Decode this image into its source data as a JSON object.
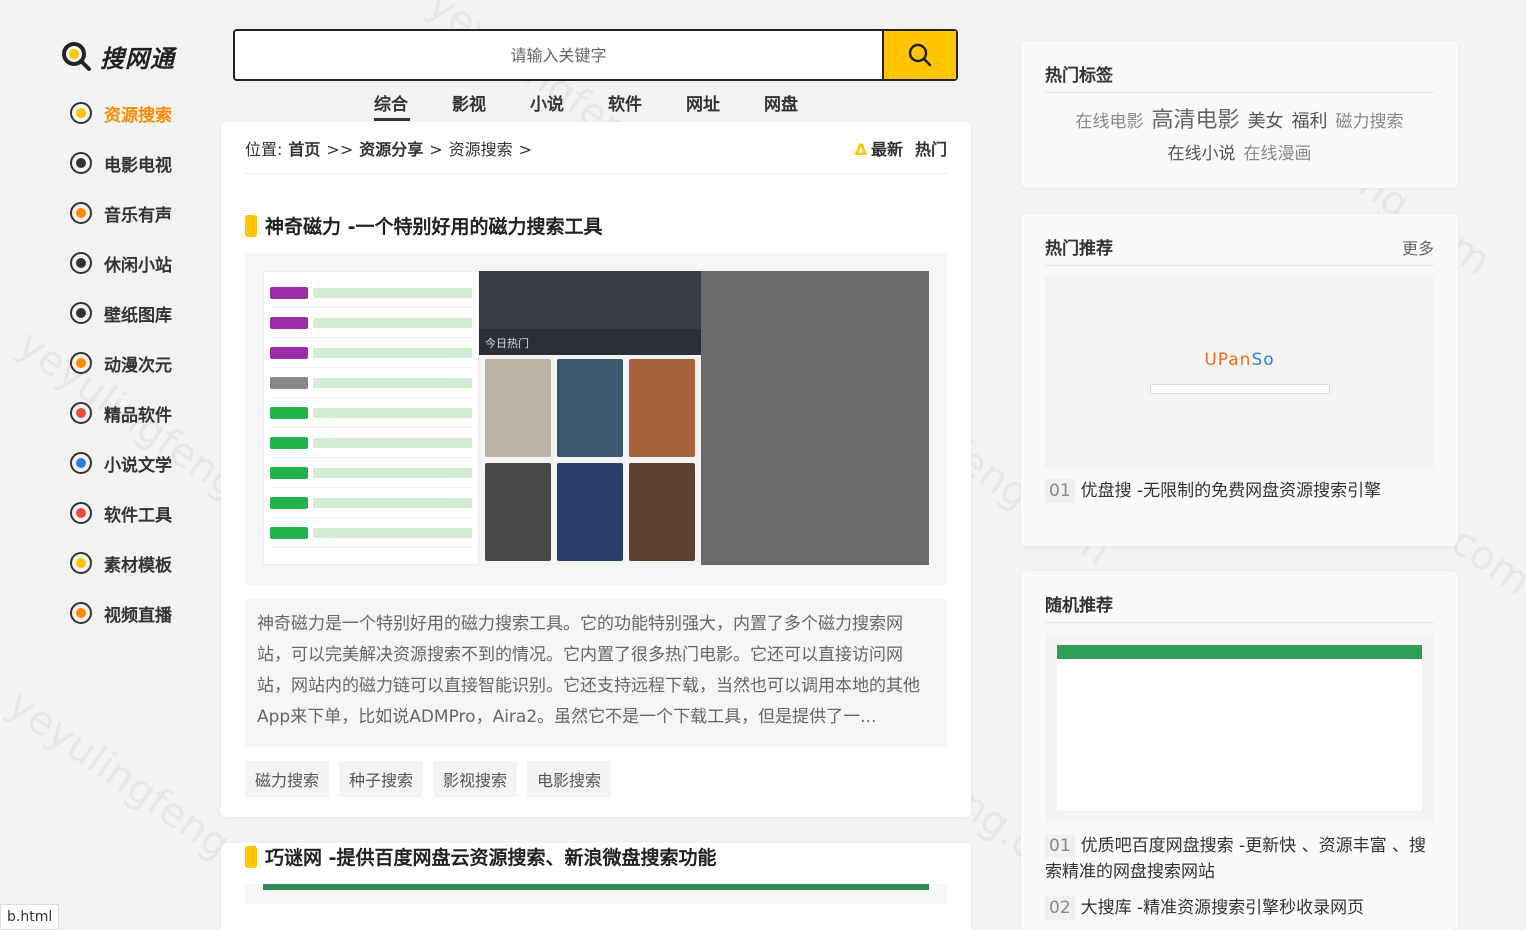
{
  "site": {
    "logo_text": "搜网通"
  },
  "search": {
    "placeholder": "请输入关键字"
  },
  "nav": [
    {
      "label": "资源搜索",
      "icon": "bulb-icon",
      "active": true
    },
    {
      "label": "电影电视",
      "icon": "film-reel-icon"
    },
    {
      "label": "音乐有声",
      "icon": "music-note-icon"
    },
    {
      "label": "休闲小站",
      "icon": "gamepad-icon"
    },
    {
      "label": "壁纸图库",
      "icon": "camera-icon"
    },
    {
      "label": "动漫次元",
      "icon": "anime-face-icon"
    },
    {
      "label": "精品软件",
      "icon": "software-icon"
    },
    {
      "label": "小说文学",
      "icon": "book-icon"
    },
    {
      "label": "软件工具",
      "icon": "tool-icon"
    },
    {
      "label": "素材模板",
      "icon": "idea-icon"
    },
    {
      "label": "视频直播",
      "icon": "video-icon"
    }
  ],
  "categories": [
    {
      "label": "综合",
      "active": true
    },
    {
      "label": "影视"
    },
    {
      "label": "小说"
    },
    {
      "label": "软件"
    },
    {
      "label": "网址"
    },
    {
      "label": "网盘"
    }
  ],
  "breadcrumb": {
    "prefix": "位置:",
    "home": "首页",
    "sep1": ">>",
    "section": "资源分享",
    "sep2": ">",
    "current": "资源搜索",
    "sep3": ">"
  },
  "sort": {
    "newest": "最新",
    "hot": "热门"
  },
  "posts": [
    {
      "title": "神奇磁力 -一个特别好用的磁力搜索工具",
      "thumb_hot_label": "今日热门",
      "description": "神奇磁力是一个特别好用的磁力搜索工具。它的功能特别强大，内置了多个磁力搜索网站，可以完美解决资源搜索不到的情况。它内置了很多热门电影。它还可以直接访问网站，网站内的磁力链可以直接智能识别。它还支持远程下载，当然也可以调用本地的其他App来下单，比如说ADMPro，Aira2。虽然它不是一个下载工具，但是提供了一...",
      "tags": [
        "磁力搜索",
        "种子搜索",
        "影视搜索",
        "电影搜索"
      ]
    },
    {
      "title": "巧谜网 -提供百度网盘云资源搜索、新浪微盘搜索功能"
    }
  ],
  "hot_tags": {
    "title": "热门标签",
    "tags": [
      "在线电影",
      "高清电影",
      "美女",
      "福利",
      "磁力搜索",
      "在线小说",
      "在线漫画"
    ]
  },
  "hot_rec": {
    "title": "热门推荐",
    "more": "更多",
    "thumb_logo_u": "UPan",
    "thumb_logo_so": "So",
    "items": [
      {
        "num": "01",
        "text": "优盘搜 -无限制的免费网盘资源搜索引擎"
      }
    ]
  },
  "random_rec": {
    "title": "随机推荐",
    "items": [
      {
        "num": "01",
        "text": "优质吧百度网盘搜索 -更新快 、资源丰富 、搜索精准的网盘搜索网站"
      },
      {
        "num": "02",
        "text": "大搜库 -精准资源搜索引擎秒收录网页"
      }
    ]
  },
  "status_bar": "b.html",
  "watermark": "yeyulingfeng.com"
}
